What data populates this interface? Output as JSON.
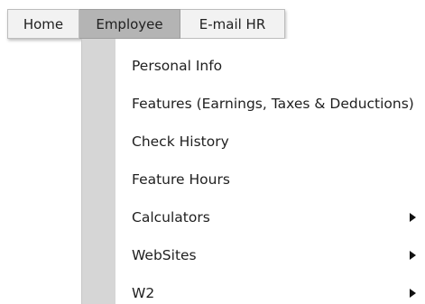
{
  "menubar": {
    "tabs": [
      {
        "label": "Home"
      },
      {
        "label": "Employee",
        "active": true
      },
      {
        "label": "E-mail HR"
      }
    ]
  },
  "dropdown": {
    "items": [
      {
        "label": "Personal Info",
        "has_submenu": false
      },
      {
        "label": "Features (Earnings, Taxes & Deductions)",
        "has_submenu": false
      },
      {
        "label": "Check History",
        "has_submenu": false
      },
      {
        "label": "Feature Hours",
        "has_submenu": false
      },
      {
        "label": "Calculators",
        "has_submenu": true
      },
      {
        "label": "WebSites",
        "has_submenu": true
      },
      {
        "label": "W2",
        "has_submenu": true
      }
    ]
  },
  "colors": {
    "active_tab_bg": "#b4b4b4",
    "tab_bg": "#f2f2f2",
    "dropdown_strip": "#d6d6d6"
  }
}
